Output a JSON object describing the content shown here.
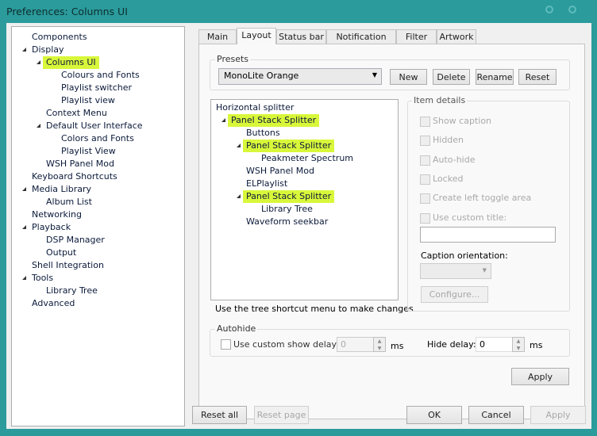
{
  "window": {
    "title": "Preferences: Columns UI"
  },
  "sidebar": {
    "items": [
      {
        "label": "Components",
        "level": 0,
        "expander": false
      },
      {
        "label": "Display",
        "level": 0,
        "expander": true
      },
      {
        "label": "Columns UI",
        "level": 1,
        "expander": true,
        "highlight": true
      },
      {
        "label": "Colours and Fonts",
        "level": 2
      },
      {
        "label": "Playlist switcher",
        "level": 2
      },
      {
        "label": "Playlist view",
        "level": 2
      },
      {
        "label": "Context Menu",
        "level": 1
      },
      {
        "label": "Default User Interface",
        "level": 1,
        "expander": true
      },
      {
        "label": "Colors and Fonts",
        "level": 2
      },
      {
        "label": "Playlist View",
        "level": 2
      },
      {
        "label": "WSH Panel Mod",
        "level": 1
      },
      {
        "label": "Keyboard Shortcuts",
        "level": 0
      },
      {
        "label": "Media Library",
        "level": 0,
        "expander": true
      },
      {
        "label": "Album List",
        "level": 1
      },
      {
        "label": "Networking",
        "level": 0
      },
      {
        "label": "Playback",
        "level": 0,
        "expander": true
      },
      {
        "label": "DSP Manager",
        "level": 1
      },
      {
        "label": "Output",
        "level": 1
      },
      {
        "label": "Shell Integration",
        "level": 0
      },
      {
        "label": "Tools",
        "level": 0,
        "expander": true
      },
      {
        "label": "Library Tree",
        "level": 1
      },
      {
        "label": "Advanced",
        "level": 0
      }
    ]
  },
  "tabs": [
    {
      "label": "Main"
    },
    {
      "label": "Layout",
      "active": true
    },
    {
      "label": "Status bar"
    },
    {
      "label": "Notification area"
    },
    {
      "label": "Filter"
    },
    {
      "label": "Artwork"
    }
  ],
  "presets": {
    "label": "Presets",
    "selected": "MonoLite Orange",
    "new": "New",
    "delete": "Delete",
    "rename": "Rename",
    "reset": "Reset"
  },
  "layout_tree": {
    "items": [
      {
        "label": "Horizontal splitter",
        "level": 0
      },
      {
        "label": "Panel Stack Splitter",
        "level": 1,
        "expander": true,
        "highlight": true
      },
      {
        "label": "Buttons",
        "level": 2
      },
      {
        "label": "Panel Stack Splitter",
        "level": 2,
        "expander": true,
        "highlight": true
      },
      {
        "label": "Peakmeter Spectrum",
        "level": 3
      },
      {
        "label": "WSH Panel Mod",
        "level": 2
      },
      {
        "label": "ELPlaylist",
        "level": 2
      },
      {
        "label": "Panel Stack Splitter",
        "level": 2,
        "expander": true,
        "highlight": true
      },
      {
        "label": "Library Tree",
        "level": 3
      },
      {
        "label": "Waveform seekbar",
        "level": 2
      }
    ],
    "hint": "Use the tree shortcut menu to make changes"
  },
  "item_details": {
    "label": "Item details",
    "show_caption": "Show caption",
    "hidden": "Hidden",
    "auto_hide": "Auto-hide",
    "locked": "Locked",
    "left_toggle": "Create left toggle area",
    "custom_title": "Use custom title:",
    "custom_title_value": "",
    "caption_orientation": "Caption orientation:",
    "configure": "Configure..."
  },
  "autohide": {
    "label": "Autohide",
    "custom_delay": "Use custom show delay of",
    "show_delay_value": "0",
    "ms1": "ms",
    "hide_delay": "Hide delay:",
    "hide_delay_value": "0",
    "ms2": "ms"
  },
  "buttons": {
    "apply_panel": "Apply",
    "reset_all": "Reset all",
    "reset_page": "Reset page",
    "ok": "OK",
    "cancel": "Cancel",
    "apply": "Apply"
  },
  "colors": {
    "titlebar": "#2b9b9c",
    "highlight": "#d9f73a"
  }
}
